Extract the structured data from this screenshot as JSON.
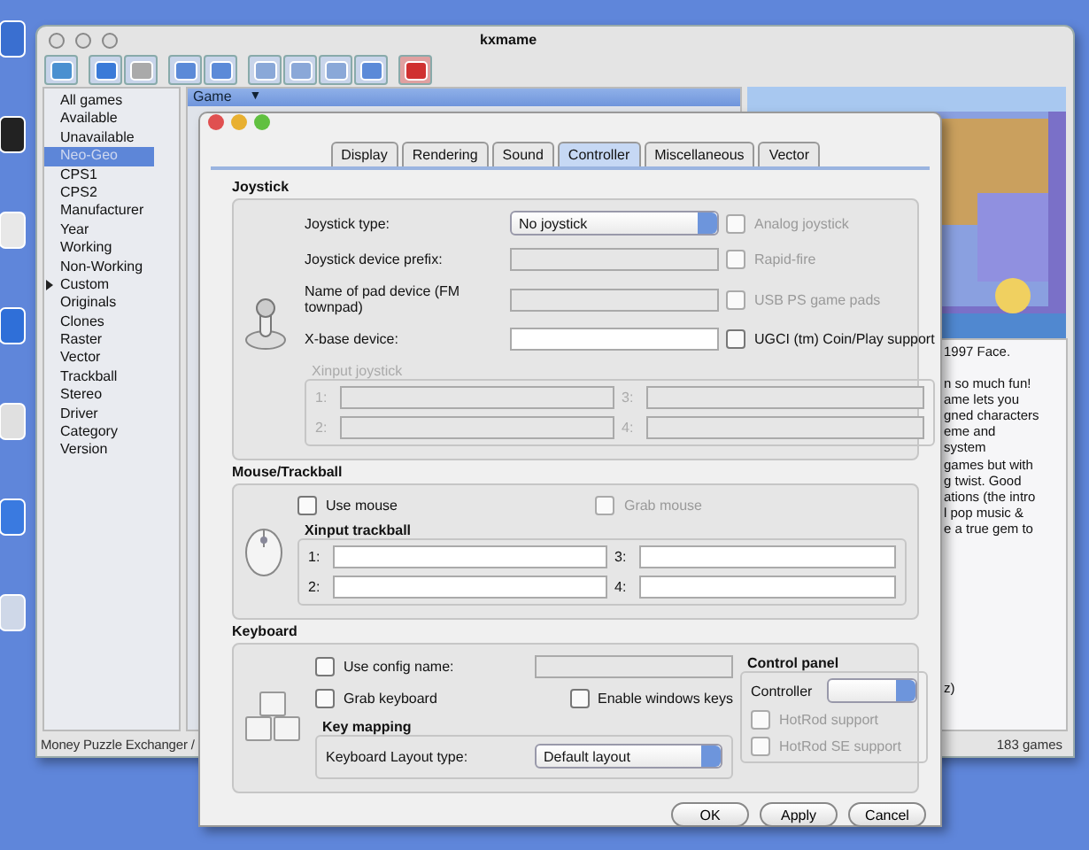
{
  "main_window": {
    "title": "kxmame",
    "categories": [
      {
        "label": "All games",
        "selected": false,
        "kind": "item"
      },
      {
        "label": "Available",
        "selected": false,
        "kind": "item"
      },
      {
        "label": "Unavailable",
        "selected": false,
        "kind": "item"
      },
      {
        "label": "Neo-Geo",
        "selected": true,
        "kind": "item"
      },
      {
        "label": "CPS1",
        "selected": false,
        "kind": "item"
      },
      {
        "label": "CPS2",
        "selected": false,
        "kind": "item"
      },
      {
        "label": "Manufacturer",
        "selected": false,
        "kind": "item"
      },
      {
        "label": "Year",
        "selected": false,
        "kind": "item"
      },
      {
        "label": "Working",
        "selected": false,
        "kind": "item"
      },
      {
        "label": "Non-Working",
        "selected": false,
        "kind": "item"
      },
      {
        "label": "Custom",
        "selected": false,
        "kind": "group"
      },
      {
        "label": "Originals",
        "selected": false,
        "kind": "item"
      },
      {
        "label": "Clones",
        "selected": false,
        "kind": "item"
      },
      {
        "label": "Raster",
        "selected": false,
        "kind": "item"
      },
      {
        "label": "Vector",
        "selected": false,
        "kind": "item"
      },
      {
        "label": "Trackball",
        "selected": false,
        "kind": "item"
      },
      {
        "label": "Stereo",
        "selected": false,
        "kind": "item"
      },
      {
        "label": "Driver",
        "selected": false,
        "kind": "item"
      },
      {
        "label": "Category",
        "selected": false,
        "kind": "item"
      },
      {
        "label": "Version",
        "selected": false,
        "kind": "item"
      }
    ],
    "list_header": {
      "label": "Game",
      "sort": "▼"
    },
    "description_blocks": [
      [
        "1997 Face."
      ],
      [
        "n so much fun!",
        "ame lets you",
        "gned characters",
        "eme and",
        "system",
        "games but with",
        "g twist. Good",
        "ations (the intro",
        "l pop music &",
        "e a true gem to"
      ],
      [
        "z)"
      ]
    ],
    "status_bar": {
      "game": "Money Puzzle Exchanger /",
      "count": "183  games"
    }
  },
  "dialog": {
    "tabs": [
      {
        "label": "Display",
        "selected": false
      },
      {
        "label": "Rendering",
        "selected": false
      },
      {
        "label": "Sound",
        "selected": false
      },
      {
        "label": "Controller",
        "selected": true
      },
      {
        "label": "Miscellaneous",
        "selected": false
      },
      {
        "label": "Vector",
        "selected": false
      }
    ],
    "joystick": {
      "title": "Joystick",
      "fields": [
        {
          "label": "Joystick type:",
          "kind": "dropdown",
          "value": "No joystick",
          "disabled": false
        },
        {
          "label": "Joystick device prefix:",
          "kind": "text",
          "disabled": true
        },
        {
          "label": "Name of pad device (FM townpad)",
          "kind": "text",
          "disabled": true
        },
        {
          "label": "X-base device:",
          "kind": "text",
          "disabled": false
        }
      ],
      "checks": [
        {
          "label": "Analog joystick",
          "checked": false,
          "disabled": true
        },
        {
          "label": "Rapid-fire",
          "checked": false,
          "disabled": true
        },
        {
          "label": "USB PS game pads",
          "checked": false,
          "disabled": true
        },
        {
          "label": "UGCI (tm) Coin/Play support",
          "checked": false,
          "disabled": false
        }
      ],
      "xinput": {
        "title": "Xinput joystick",
        "disabled": true,
        "slots": [
          "1:",
          "3:",
          "2:",
          "4:"
        ]
      }
    },
    "mouse": {
      "title": "Mouse/Trackball",
      "checks": [
        {
          "label": "Use mouse",
          "checked": false,
          "disabled": false
        },
        {
          "label": "Grab mouse",
          "checked": false,
          "disabled": true
        }
      ],
      "xinput": {
        "title": "Xinput trackball",
        "disabled": false,
        "slots": [
          "1:",
          "3:",
          "2:",
          "4:"
        ]
      }
    },
    "keyboard": {
      "title": "Keyboard",
      "use_config": {
        "label": "Use config name:",
        "checked": false,
        "disabled": false
      },
      "checks": [
        {
          "label": "Grab keyboard",
          "checked": false,
          "disabled": false
        },
        {
          "label": "Enable windows keys",
          "checked": false,
          "disabled": false
        }
      ],
      "key_mapping": {
        "title": "Key mapping",
        "label": "Keyboard Layout type:",
        "value": "Default layout"
      },
      "control_panel": {
        "title": "Control panel",
        "label": "Controller",
        "checks": [
          {
            "label": "HotRod support",
            "checked": false,
            "disabled": true
          },
          {
            "label": "HotRod SE support",
            "checked": false,
            "disabled": true
          }
        ]
      }
    },
    "buttons": [
      "OK",
      "Apply",
      "Cancel"
    ]
  }
}
